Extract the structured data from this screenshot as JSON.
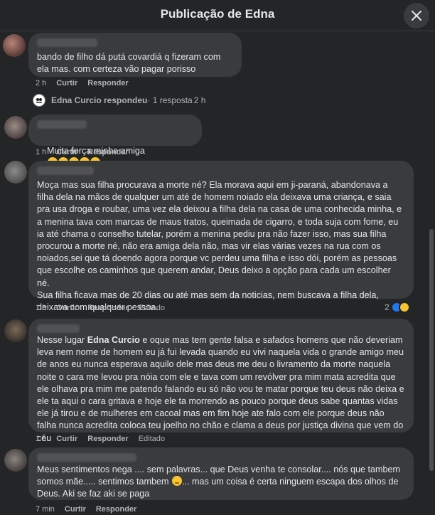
{
  "header": {
    "title": "Publicação de Edna"
  },
  "comments": [
    {
      "text": "bando de filho dá putá covardiá q fizeram com ela mas. com certeza vão pagar porisso",
      "time": "2 h",
      "like": "Curtir",
      "reply": "Responder"
    },
    {
      "reply_thread": {
        "name": "Edna Curcio respondeu",
        "count": " · 1 resposta",
        "time": "2 h"
      }
    },
    {
      "text": "Muita força minha amiga",
      "emojis": [
        "cry",
        "cry",
        "cry",
        "sad",
        "sad"
      ],
      "time": "1 h",
      "like": "Curtir",
      "reply": "Responder"
    },
    {
      "text": "Moça mas sua filha procurava a morte né? Ela morava aqui em ji-paraná, abandonava a filha dela na mãos de qualquer um até de homem noiado ela deixava uma criança, e saia pra usa droga e roubar, uma vez ela deixou a filha dela na casa de uma conhecida minha, e a menina tava com marcas de maus tratos, queimada de cigarro, e toda suja com fome, eu ia até chama o conselho tutelar, porém a menina pediu pra não fazer isso, mas sua filha procurou a morte né, não era amiga dela não, mas vir elas várias vezes na rua com os noiados,sei que tá doendo agora porque vc perdeu uma filha e isso dói, porém as pessoas que escolhe os caminhos que querem andar, Deus deixo a opção para cada um escolher né.\nSua filha ficava mas de 20 dias ou até mas sem da noticias, nem buscava a filha dela, deixava com qualquer pessoa.",
      "time": "1 h",
      "like": "Curtir",
      "reply": "Responder",
      "edited": "Editado",
      "reaction_count": "2"
    },
    {
      "text_before": "Nesse lugar ",
      "mention": "Edna Curcio",
      "text_after": " e oque mas tem gente falsa e safados homens que não deveriam leva nem nome de homem eu já fui levada quando eu vivi naquela vida o grande amigo meu de anos eu nunca esperava aquilo dele mas deus me deu o livramento da morte naquela noite o cara me levou pra nóia com ele e tava com um revólver pra mim mata acredita que ele olhava pra mim me patendo falando eu só não vou te matar porque teu deus não deixa e ele ta aqui o cara gritava e hoje ele ta morrendo as pouco porque deus sabe quantas vidas ele já tirou e de mulheres em cacoal mas em fim hoje ate falo com ele porque deus não falha nunca acredita coloca teu joelho no chão e clama a deus por justiça divina que vem do céu",
      "time": "1 h",
      "like": "Curtir",
      "reply": "Responder",
      "edited": "Editado"
    },
    {
      "text_part1": "Meus sentimentos nega .... sem palavras... que Deus venha te consolar.... nós que tambem somos mãe..... sentimos tambem ",
      "text_part2": "... mas um coisa é certa ninguem escapa dos olhos de Deus. Aki se faz aki se paga",
      "time": "7 min",
      "like": "Curtir",
      "reply": "Responder"
    }
  ],
  "colors": {
    "background": "#242526",
    "bubble": "#3a3b3c",
    "text": "#e4e6eb",
    "muted": "#b0b3b8",
    "like_blue": "#2078f4"
  }
}
